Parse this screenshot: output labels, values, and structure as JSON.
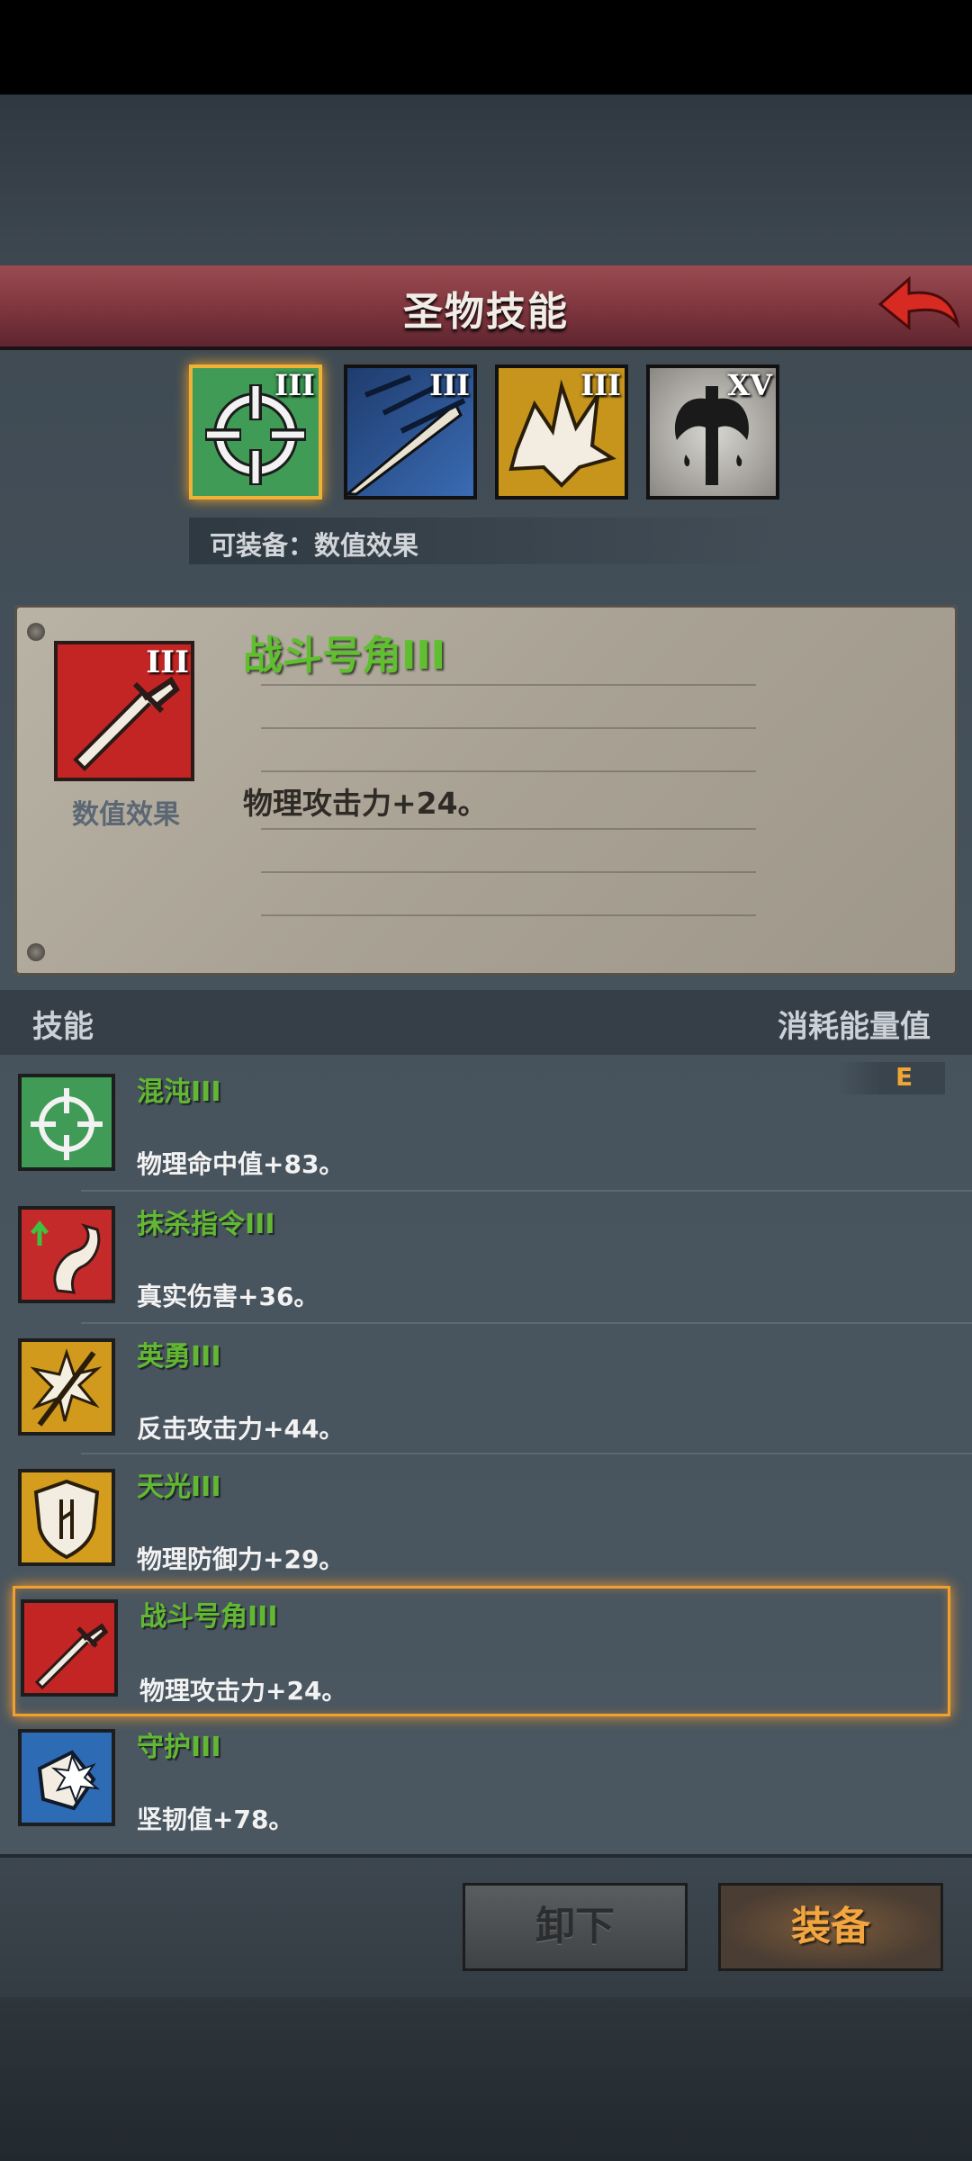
{
  "title": "圣物技能",
  "relic_slots": [
    {
      "numeral": "III",
      "icon": "crosshair-icon",
      "selected": true
    },
    {
      "numeral": "III",
      "icon": "claw-slash-icon",
      "selected": false
    },
    {
      "numeral": "III",
      "icon": "beast-fur-icon",
      "selected": false
    },
    {
      "numeral": "XV",
      "icon": "axe-blood-icon",
      "selected": false
    }
  ],
  "equip_hint": "可装备：数值效果",
  "detail": {
    "numeral": "III",
    "type": "数值效果",
    "name": "战斗号角III",
    "desc": "物理攻击力+24。"
  },
  "list_header": {
    "left": "技能",
    "right": "消耗能量值"
  },
  "energy_value": "E",
  "skills": [
    {
      "name": "混沌III",
      "desc": "物理命中值+83。",
      "icon": "crosshair-icon",
      "color": "#3f9b55"
    },
    {
      "name": "抹杀指令III",
      "desc": "真实伤害+36。",
      "icon": "strike-arm-icon",
      "color": "#c52a2a"
    },
    {
      "name": "英勇III",
      "desc": "反击攻击力+44。",
      "icon": "spear-burst-icon",
      "color": "#d19a1c"
    },
    {
      "name": "天光III",
      "desc": "物理防御力+29。",
      "icon": "shield-icon",
      "color": "#d59d1e"
    },
    {
      "name": "战斗号角III",
      "desc": "物理攻击力+24。",
      "icon": "sword-icon",
      "color": "#c32424",
      "selected": true
    },
    {
      "name": "守护III",
      "desc": "坚韧值+78。",
      "icon": "guard-burst-icon",
      "color": "#2d6bb5"
    }
  ],
  "buttons": {
    "unequip": "卸下",
    "equip": "装备"
  }
}
